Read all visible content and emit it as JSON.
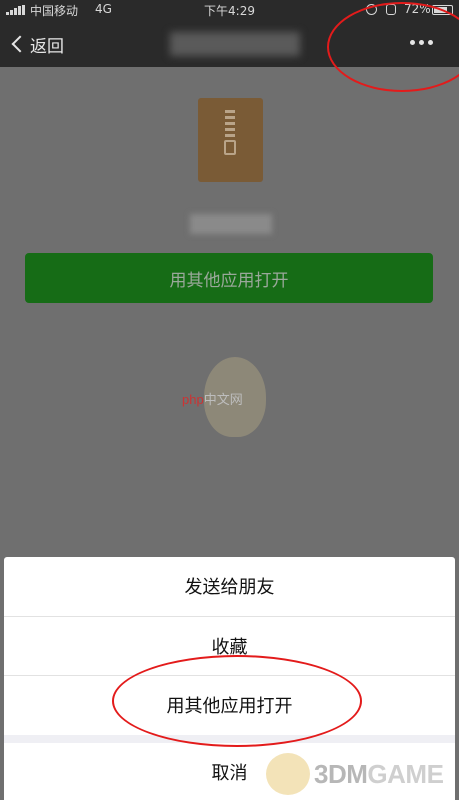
{
  "status_bar": {
    "carrier": "中国移动",
    "network": "4G",
    "time": "下午4:29",
    "battery_percent": "72%"
  },
  "nav": {
    "back_label": "返回",
    "more_icon": "more-horizontal-icon"
  },
  "content": {
    "file_icon": "zip-archive-icon",
    "open_other_label": "用其他应用打开"
  },
  "action_sheet": {
    "items": [
      {
        "label": "发送给朋友"
      },
      {
        "label": "收藏"
      },
      {
        "label": "用其他应用打开"
      }
    ],
    "cancel_label": "取消"
  },
  "watermarks": {
    "php_logo": "php中文网",
    "game_logo": "3DMGAME"
  },
  "colors": {
    "annotation_red": "#e31b1b",
    "green_button": "#166c16",
    "nav_bg": "#2a2a2a"
  }
}
